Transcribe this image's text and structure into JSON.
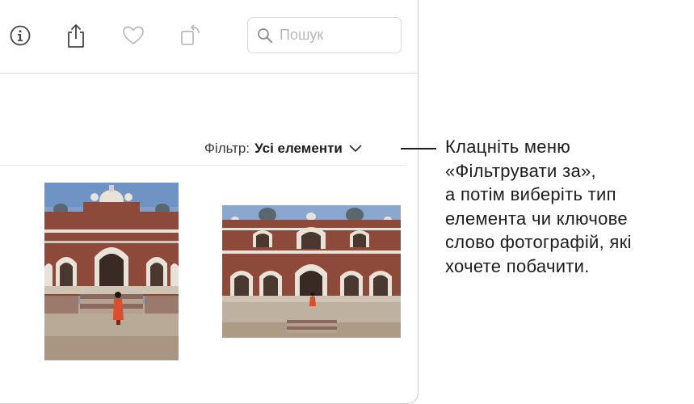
{
  "toolbar": {
    "icons": [
      "info-icon",
      "share-icon",
      "heart-icon",
      "rotate-icon"
    ],
    "search_placeholder": "Пошук",
    "search_value": ""
  },
  "filter": {
    "label": "Фільтр:",
    "value": "Усі елементи"
  },
  "photos": [
    {
      "subject": "Humayun's Tomb, portrait orientation"
    },
    {
      "subject": "Humayun's Tomb, landscape orientation"
    }
  ],
  "callout": {
    "lines": [
      "Клацніть меню",
      "«Фільтрувати за»,",
      "а потім виберіть тип",
      "елемента чи ключове",
      "слово фотографій, які",
      "хочете побачити."
    ]
  },
  "colors": {
    "sky": "#7f9fc8",
    "sandstone": "#8d4a3a",
    "marble": "#e8e2d8",
    "ground": "#b9aa98",
    "figure": "#d94e2c"
  }
}
